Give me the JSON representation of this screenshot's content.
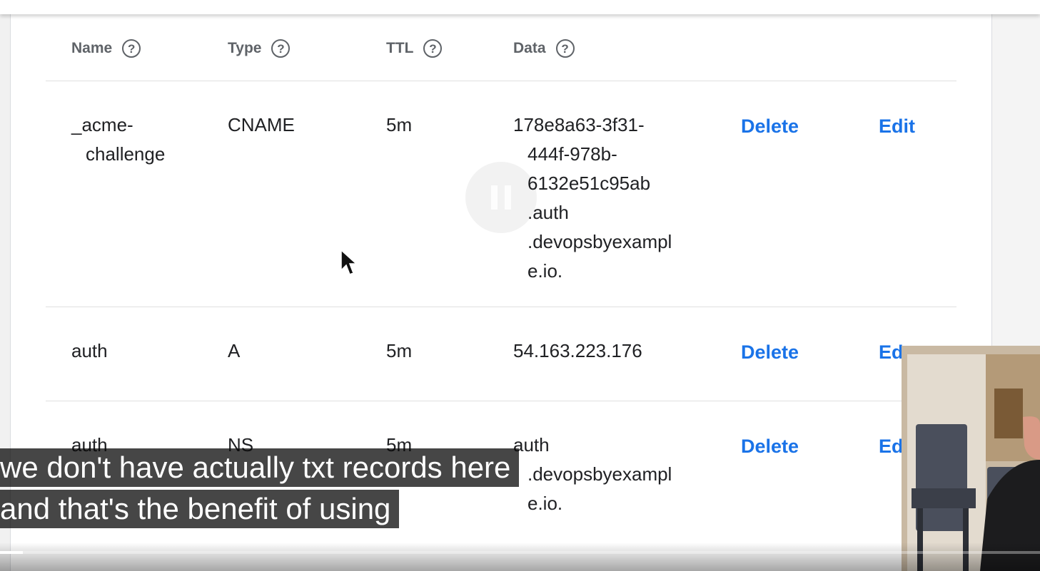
{
  "table": {
    "columns": [
      {
        "label": "Name",
        "help": "?"
      },
      {
        "label": "Type",
        "help": "?"
      },
      {
        "label": "TTL",
        "help": "?"
      },
      {
        "label": "Data",
        "help": "?"
      }
    ],
    "rows": [
      {
        "name": [
          "_acme-",
          "challenge"
        ],
        "type": "CNAME",
        "ttl": "5m",
        "data": [
          "178e8a63-3f31-",
          "444f-978b-",
          "6132e51c95ab",
          ".auth",
          ".devopsbyexampl",
          "e.io."
        ],
        "delete": "Delete",
        "edit": "Edit"
      },
      {
        "name": [
          "auth"
        ],
        "type": "A",
        "ttl": "5m",
        "data": [
          "54.163.223.176"
        ],
        "delete": "Delete",
        "edit": "Ed"
      },
      {
        "name": [
          "auth"
        ],
        "type": "NS",
        "ttl": "5m",
        "data": [
          "auth",
          ".devopsbyexampl",
          "e.io."
        ],
        "delete": "Delete",
        "edit": "Ed"
      }
    ]
  },
  "player": {
    "captions": [
      "we don't have actually txt records here",
      "and that's the benefit of using"
    ],
    "progress_fraction": 0.022
  },
  "colors": {
    "link": "#1a73e8",
    "header_text": "#5f6368",
    "caption_bg": "#080808"
  },
  "icons": [
    "help-circle-icon",
    "pause-icon",
    "mouse-pointer-icon"
  ]
}
